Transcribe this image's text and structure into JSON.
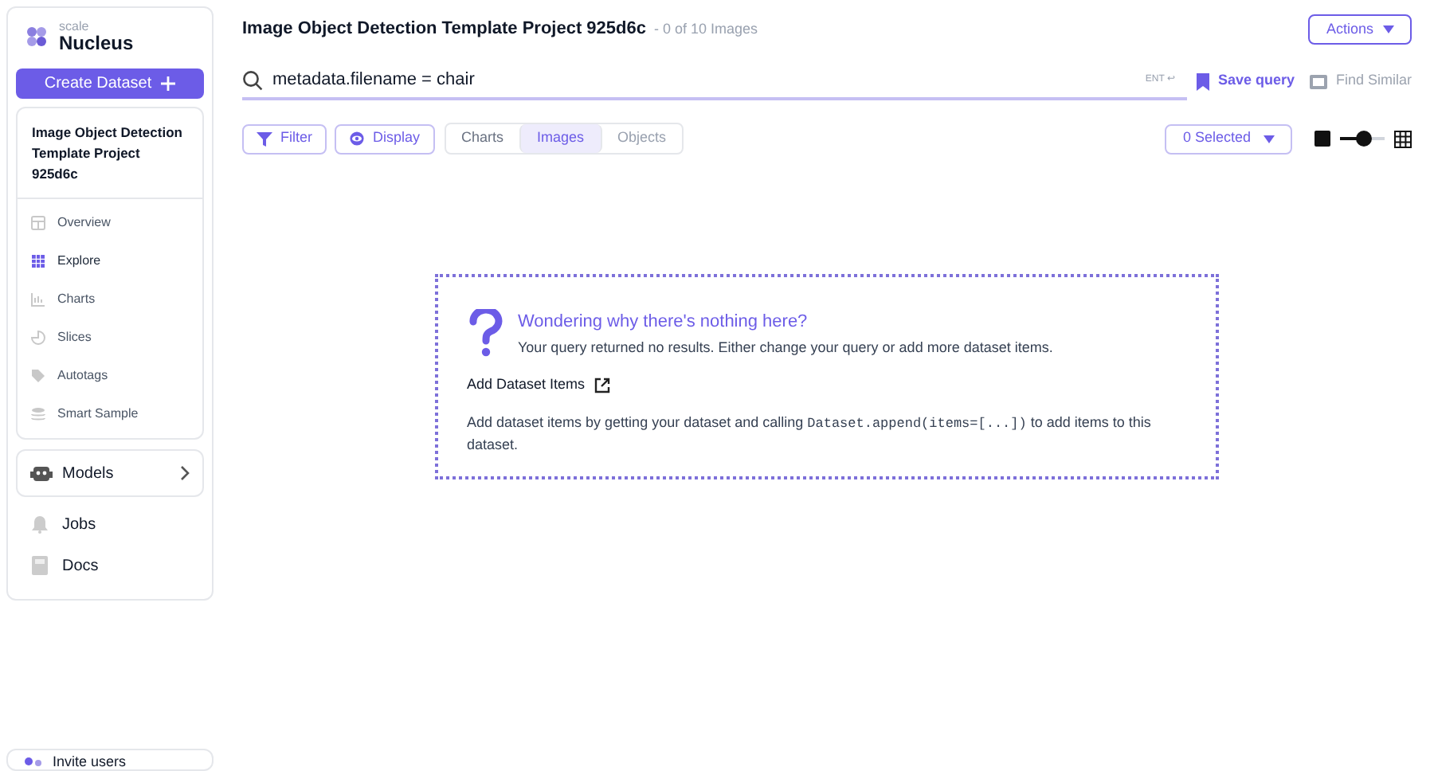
{
  "brand": {
    "small": "scale",
    "name": "Nucleus"
  },
  "create_button": "Create Dataset",
  "project": {
    "title": "Image Object Detection Template Project 925d6c"
  },
  "nav": [
    {
      "label": "Overview",
      "selected": false
    },
    {
      "label": "Explore",
      "selected": true
    },
    {
      "label": "Charts",
      "selected": false
    },
    {
      "label": "Slices",
      "selected": false
    },
    {
      "label": "Autotags",
      "selected": false
    },
    {
      "label": "Smart Sample",
      "selected": false
    }
  ],
  "models": {
    "label": "Models"
  },
  "links": [
    {
      "label": "Jobs"
    },
    {
      "label": "Docs"
    }
  ],
  "invite": {
    "label": "Invite users"
  },
  "header": {
    "title": "Image Object Detection Template Project 925d6c",
    "count": "- 0 of 10 Images",
    "actions": "Actions"
  },
  "search": {
    "value": "metadata.filename = chair",
    "hint": "ENT ↩",
    "save": "Save query",
    "find_similar": {
      "label": "Find Similar",
      "disabled": true
    }
  },
  "toolbar": {
    "filter": "Filter",
    "display": "Display",
    "tabs": [
      {
        "label": "Charts",
        "selected": false,
        "disabled": false
      },
      {
        "label": "Images",
        "selected": true,
        "disabled": false
      },
      {
        "label": "Objects",
        "selected": false,
        "disabled": true
      }
    ],
    "selected_button": "0 Selected",
    "zoom": {
      "level": 0.55
    }
  },
  "empty": {
    "title": "Wondering why there's nothing here?",
    "message": "Your query returned no results. Either change your query or add more dataset items.",
    "link": "Add Dataset Items",
    "text_before": "Add dataset items by getting your dataset and calling ",
    "code": "Dataset.append(items=[...])",
    "text_after": " to add items to this dataset."
  }
}
